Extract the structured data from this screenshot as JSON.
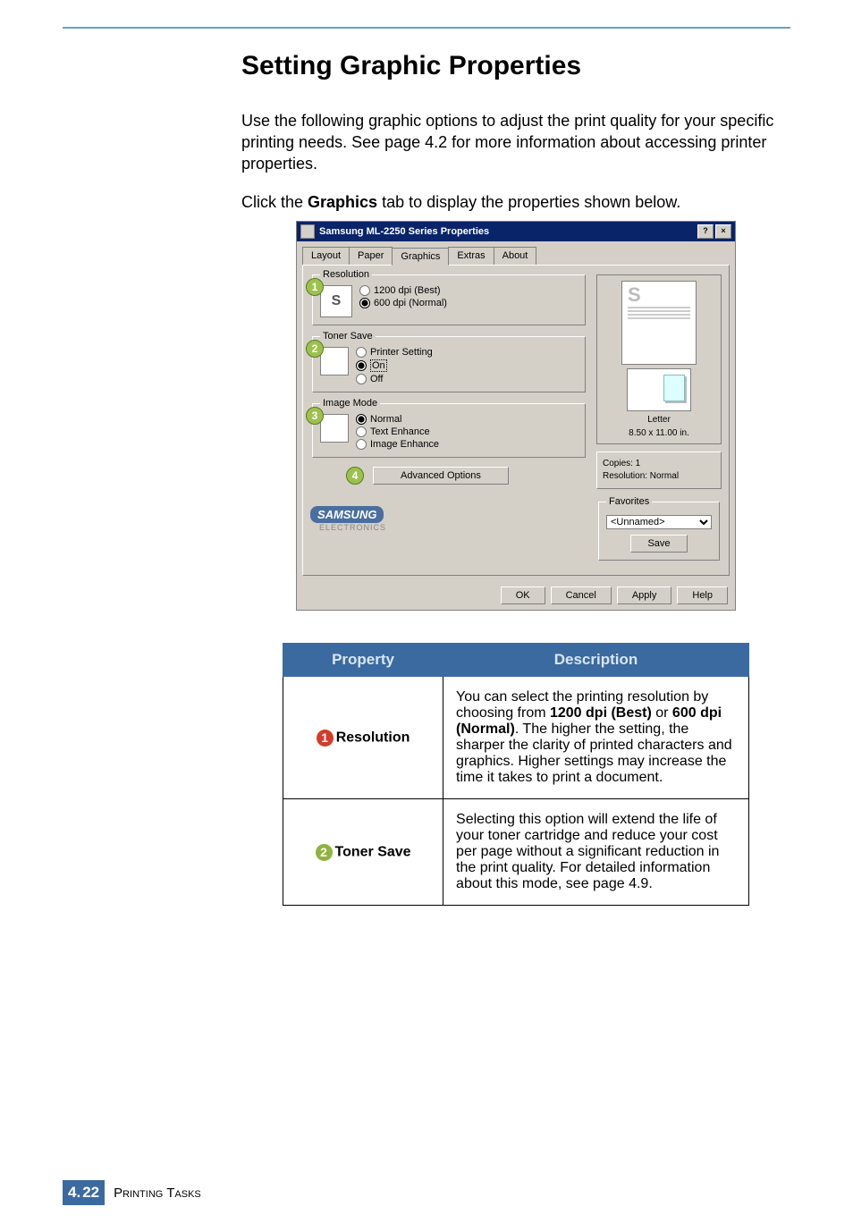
{
  "heading": "Setting Graphic Properties",
  "intro": "Use the following graphic options to adjust the print quality for your specific printing needs. See page 4.2 for more information about accessing printer properties.",
  "click_line_pre": "Click the ",
  "click_line_bold": "Graphics",
  "click_line_post": " tab to display the properties shown below.",
  "dlg": {
    "title": "Samsung ML-2250 Series Properties",
    "help_btn": "?",
    "close_btn": "×",
    "tabs": [
      "Layout",
      "Paper",
      "Graphics",
      "Extras",
      "About"
    ],
    "active_tab": "Graphics",
    "groups": {
      "resolution": {
        "legend": "Resolution",
        "bubble": "1",
        "thumb_letter": "S",
        "opts": [
          "1200 dpi (Best)",
          "600 dpi (Normal)"
        ],
        "selected": 1
      },
      "toner": {
        "legend": "Toner Save",
        "bubble": "2",
        "opts": [
          "Printer Setting",
          "On",
          "Off"
        ],
        "selected": 1
      },
      "image": {
        "legend": "Image Mode",
        "bubble": "3",
        "opts": [
          "Normal",
          "Text Enhance",
          "Image Enhance"
        ],
        "selected": 0
      }
    },
    "adv_bubble": "4",
    "adv_btn": "Advanced Options",
    "preview": {
      "letter_label": "Letter",
      "letter_size": "8.50 x 11.00 in.",
      "copies": "Copies: 1",
      "res": "Resolution: Normal",
      "fav_legend": "Favorites",
      "fav_value": "<Unnamed>",
      "save_btn": "Save"
    },
    "brand": "SAMSUNG",
    "brand_sub": "ELECTRONICS",
    "buttons": [
      "OK",
      "Cancel",
      "Apply",
      "Help"
    ]
  },
  "table": {
    "headers": [
      "Property",
      "Description"
    ],
    "rows": [
      {
        "num": "1",
        "num_class": "c-red",
        "name": "Resolution",
        "desc_plain1": "You can select the printing resolution by choosing from ",
        "desc_b1": "1200 dpi (Best)",
        "desc_plain2": " or ",
        "desc_b2": "600 dpi (Normal)",
        "desc_plain3": ". The higher the setting, the sharper the clarity of printed characters and graphics. Higher settings may increase the time it takes to print a document."
      },
      {
        "num": "2",
        "num_class": "c-grn",
        "name": "Toner Save",
        "desc_plain1": "Selecting this option will extend the life of your toner cartridge and reduce your cost per page without a significant reduction in the print quality. For detailed information about this mode, see page 4.9.",
        "desc_b1": "",
        "desc_plain2": "",
        "desc_b2": "",
        "desc_plain3": ""
      }
    ]
  },
  "footer": {
    "chapter": "4.",
    "page": "22",
    "label": "Printing Tasks"
  }
}
